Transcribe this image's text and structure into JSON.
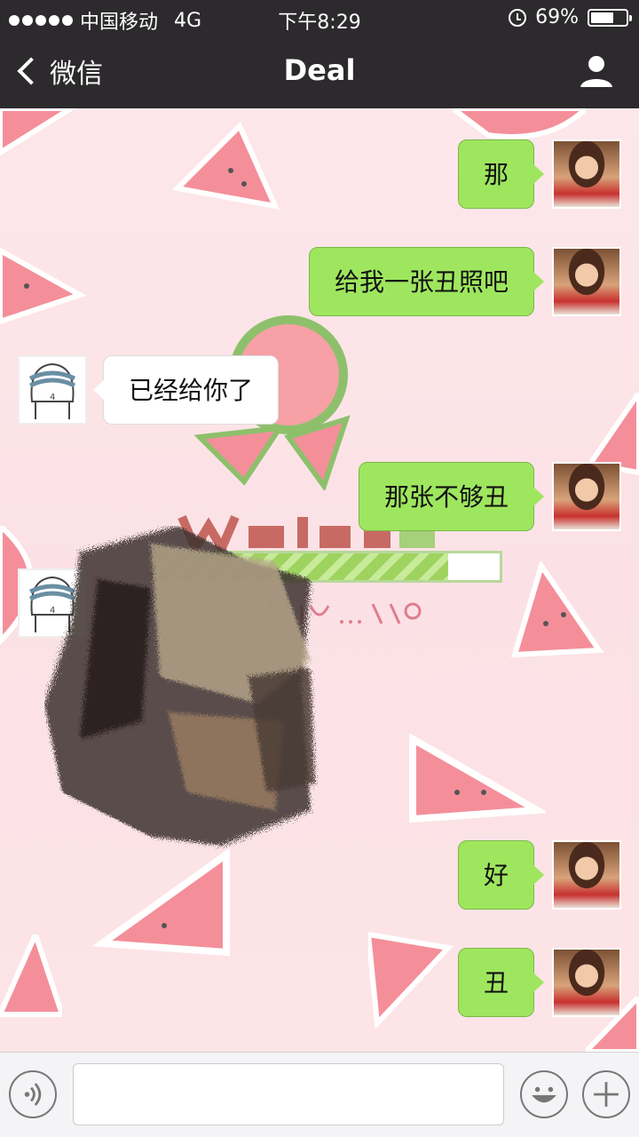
{
  "status": {
    "carrier": "中国移动",
    "network": "4G",
    "time": "下午8:29",
    "battery": "69%",
    "battery_level": 0.69
  },
  "nav": {
    "back_label": "微信",
    "title": "Deal"
  },
  "messages": [
    {
      "side": "out",
      "text": "那"
    },
    {
      "side": "out",
      "text": "给我一张丑照吧"
    },
    {
      "side": "in",
      "text": "已经给你了"
    },
    {
      "side": "out",
      "text": "那张不够丑"
    },
    {
      "side": "in",
      "text": ""
    },
    {
      "side": "out",
      "text": "好"
    },
    {
      "side": "out",
      "text": "丑"
    }
  ],
  "image_message": {
    "progress_value": 0.85
  },
  "input": {
    "value": "",
    "placeholder": ""
  },
  "icons": {
    "back": "chevron-left-icon",
    "contact": "person-icon",
    "voice": "voice-icon",
    "emoji": "emoji-icon",
    "add": "plus-icon"
  },
  "colors": {
    "nav_bg": "#2c2a2c",
    "outgoing_bubble": "#9fe65f",
    "incoming_bubble": "#ffffff",
    "chat_bg": "#fbe3e6"
  }
}
